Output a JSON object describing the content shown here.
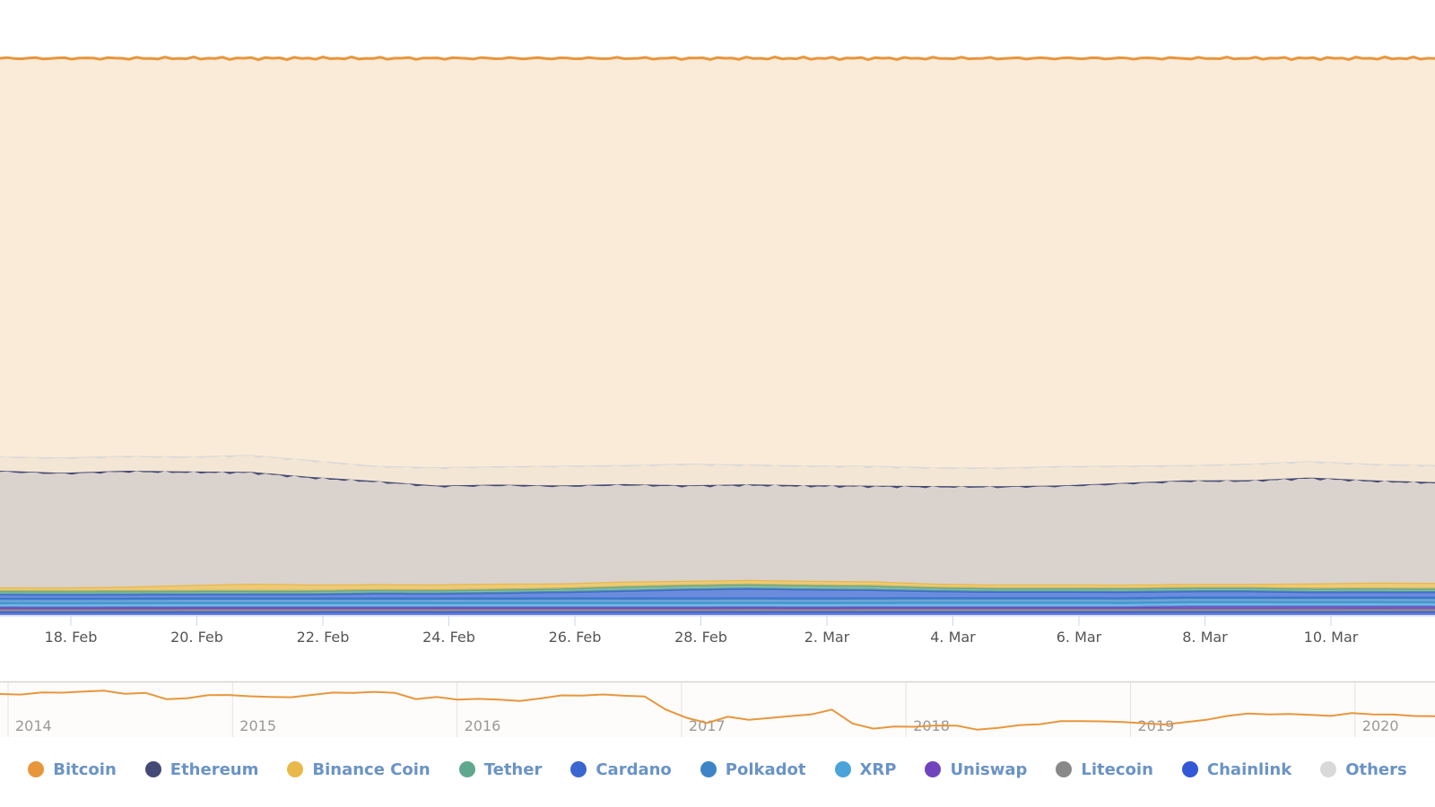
{
  "chart_data": {
    "type": "area",
    "stacking": "percent",
    "title": "",
    "xlabel": "",
    "ylabel": "",
    "ylim": [
      0,
      100
    ],
    "grid": true,
    "legend_position": "bottom",
    "x_ticks": [
      "18. Feb",
      "20. Feb",
      "22. Feb",
      "24. Feb",
      "26. Feb",
      "28. Feb",
      "2. Mar",
      "4. Mar",
      "6. Mar",
      "8. Mar",
      "10. Mar"
    ],
    "x": [
      "16. Feb",
      "17. Feb",
      "18. Feb",
      "19. Feb",
      "20. Feb",
      "21. Feb",
      "22. Feb",
      "23. Feb",
      "24. Feb",
      "25. Feb",
      "26. Feb",
      "27. Feb",
      "28. Feb",
      "1. Mar",
      "2. Mar",
      "3. Mar",
      "4. Mar",
      "5. Mar",
      "6. Mar",
      "7. Mar",
      "8. Mar",
      "9. Mar",
      "10. Mar",
      "11. Mar"
    ],
    "series": [
      {
        "name": "Bitcoin",
        "color": "#e8963c",
        "values": [
          61.5,
          62.0,
          61.4,
          61.0,
          60.6,
          61.4,
          61.9,
          62.5,
          62.2,
          61.6,
          61.8,
          61.5,
          61.2,
          61.8,
          61.4,
          61.2,
          61.3,
          61.0,
          61.3,
          61.3,
          61.0,
          60.9,
          61.1,
          61.8
        ]
      },
      {
        "name": "Others",
        "color": "#d9d9d9",
        "values": [
          2.2,
          2.4,
          2.3,
          2.3,
          2.6,
          2.6,
          2.3,
          2.8,
          2.8,
          3.0,
          2.9,
          3.3,
          3.0,
          3.0,
          3.0,
          2.8,
          2.8,
          2.9,
          2.6,
          2.3,
          2.5,
          2.5,
          2.5,
          2.6
        ]
      },
      {
        "name": "Ethereum",
        "color": "#454a75",
        "values": [
          18.0,
          17.8,
          17.9,
          17.4,
          17.1,
          16.4,
          15.7,
          15.1,
          15.1,
          14.8,
          14.8,
          14.5,
          14.4,
          14.5,
          14.4,
          14.6,
          14.7,
          14.8,
          15.3,
          15.6,
          15.6,
          16.0,
          15.4,
          15.3
        ]
      },
      {
        "name": "Binance Coin",
        "color": "#e8b84a",
        "values": [
          0.6,
          0.6,
          0.7,
          0.9,
          1.1,
          1.0,
          0.9,
          0.9,
          0.9,
          0.8,
          0.8,
          0.7,
          0.7,
          0.7,
          0.7,
          0.6,
          0.6,
          0.6,
          0.6,
          0.6,
          0.6,
          0.8,
          0.9,
          0.9
        ]
      },
      {
        "name": "Tether",
        "color": "#5fa88e",
        "values": [
          0.5,
          0.5,
          0.5,
          0.5,
          0.5,
          0.5,
          0.5,
          0.5,
          0.5,
          0.5,
          0.6,
          0.6,
          0.6,
          0.6,
          0.6,
          0.5,
          0.5,
          0.5,
          0.5,
          0.5,
          0.5,
          0.5,
          0.5,
          0.5
        ]
      },
      {
        "name": "Cardano",
        "color": "#3a66d1",
        "values": [
          0.7,
          0.7,
          0.7,
          0.7,
          0.7,
          0.7,
          0.8,
          0.8,
          0.9,
          1.0,
          1.2,
          1.4,
          1.5,
          1.4,
          1.3,
          1.1,
          1.0,
          1.0,
          1.0,
          1.0,
          1.0,
          0.9,
          0.9,
          0.9
        ]
      },
      {
        "name": "Polkadot",
        "color": "#3d85c6",
        "values": [
          0.7,
          0.7,
          0.7,
          0.7,
          0.7,
          0.7,
          0.7,
          0.7,
          0.7,
          0.7,
          0.7,
          0.7,
          0.7,
          0.7,
          0.7,
          0.7,
          0.7,
          0.7,
          0.7,
          0.7,
          0.7,
          0.7,
          0.7,
          0.7
        ]
      },
      {
        "name": "XRP",
        "color": "#4aa3d9",
        "values": [
          0.6,
          0.6,
          0.6,
          0.6,
          0.6,
          0.6,
          0.6,
          0.6,
          0.6,
          0.6,
          0.6,
          0.6,
          0.6,
          0.6,
          0.6,
          0.6,
          0.6,
          0.6,
          0.6,
          0.6,
          0.6,
          0.6,
          0.6,
          0.6
        ]
      },
      {
        "name": "Uniswap",
        "color": "#7044bd",
        "values": [
          0.3,
          0.3,
          0.3,
          0.3,
          0.3,
          0.3,
          0.3,
          0.3,
          0.3,
          0.3,
          0.3,
          0.3,
          0.3,
          0.3,
          0.3,
          0.3,
          0.3,
          0.3,
          0.3,
          0.4,
          0.4,
          0.4,
          0.4,
          0.4
        ]
      },
      {
        "name": "Litecoin",
        "color": "#888888",
        "values": [
          0.4,
          0.4,
          0.4,
          0.4,
          0.4,
          0.4,
          0.4,
          0.4,
          0.4,
          0.4,
          0.4,
          0.4,
          0.4,
          0.4,
          0.4,
          0.4,
          0.4,
          0.4,
          0.4,
          0.4,
          0.4,
          0.4,
          0.4,
          0.4
        ]
      },
      {
        "name": "Chainlink",
        "color": "#3357d6",
        "values": [
          0.5,
          0.5,
          0.5,
          0.5,
          0.5,
          0.5,
          0.5,
          0.5,
          0.5,
          0.5,
          0.5,
          0.5,
          0.5,
          0.5,
          0.5,
          0.5,
          0.5,
          0.5,
          0.5,
          0.5,
          0.5,
          0.5,
          0.5,
          0.5
        ]
      }
    ],
    "navigator": {
      "series": "Bitcoin",
      "x_ticks": [
        "2014",
        "2015",
        "2016",
        "2017",
        "2018",
        "2019",
        "2020"
      ],
      "values": [
        88,
        88,
        89,
        90,
        91,
        91,
        89,
        89,
        82,
        84,
        86,
        87,
        86,
        84,
        85,
        87,
        89,
        90,
        90,
        89,
        83,
        84,
        82,
        83,
        81,
        81,
        83,
        86,
        87,
        87,
        86,
        86,
        70,
        62,
        56,
        62,
        60,
        61,
        63,
        66,
        70,
        55,
        50,
        51,
        52,
        53,
        52,
        49,
        50,
        53,
        55,
        57,
        58,
        58,
        56,
        56,
        54,
        56,
        60,
        63,
        66,
        66,
        65,
        65,
        64,
        66,
        66,
        65,
        63,
        64
      ]
    },
    "legend": [
      "Bitcoin",
      "Ethereum",
      "Binance Coin",
      "Tether",
      "Cardano",
      "Polkadot",
      "XRP",
      "Uniswap",
      "Litecoin",
      "Chainlink",
      "Others"
    ]
  },
  "legend": {
    "items": [
      {
        "label": "Bitcoin",
        "color": "#e8963c"
      },
      {
        "label": "Ethereum",
        "color": "#454a75"
      },
      {
        "label": "Binance Coin",
        "color": "#e8b84a"
      },
      {
        "label": "Tether",
        "color": "#5fa88e"
      },
      {
        "label": "Cardano",
        "color": "#3a66d1"
      },
      {
        "label": "Polkadot",
        "color": "#3d85c6"
      },
      {
        "label": "XRP",
        "color": "#4aa3d9"
      },
      {
        "label": "Uniswap",
        "color": "#7044bd"
      },
      {
        "label": "Litecoin",
        "color": "#888888"
      },
      {
        "label": "Chainlink",
        "color": "#3357d6"
      },
      {
        "label": "Others",
        "color": "#d9d9d9"
      }
    ]
  }
}
